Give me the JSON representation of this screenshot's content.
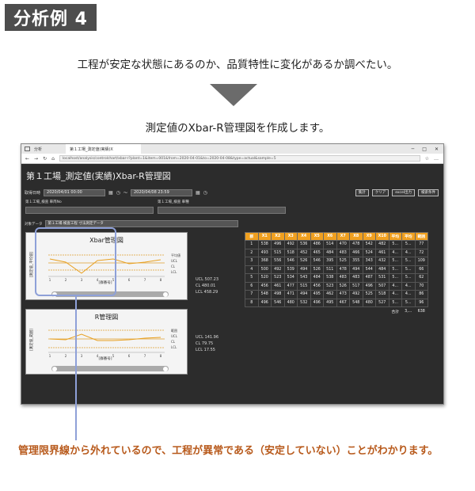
{
  "badge": "分析例 4",
  "intro": "工程が安定な状態にあるのか、品質特性に変化があるか調べたい。",
  "subtitle": "測定値のXbar-R管理図を作成します。",
  "browser": {
    "tab1": "分析",
    "tab2": "第１工場_測定値(実績)X",
    "url": "localhost/analysis/controlchart/xbar-r?plant=1&item=001&from=2020-04-01&to=2020-04-08&type=actual&sample=5",
    "win_min": "─",
    "win_max": "□",
    "win_close": "✕"
  },
  "app": {
    "title": "第１工場_測定値(実績)Xbar-R管理図",
    "date_label": "取得日時",
    "from": "2020/04/01 00:00",
    "to": "2020/04/08 23:59",
    "range_sep": "～",
    "buttons": [
      "集計",
      "クリア",
      "excel出力",
      "検索条件"
    ],
    "label_a": "第１工場_検査 車両No",
    "label_b": "第１工場_検査 車種",
    "target_label": "対象データ",
    "target_value": "第１工場 検査工程 寸法測定データ"
  },
  "xbar": {
    "title": "Xbar管理図",
    "ylabel": "[測定値_平均値]",
    "xlabel": "[群番号]",
    "legend": [
      "平均値",
      "UCL",
      "CL",
      "LCL"
    ],
    "stats": [
      "UCL  507.23",
      "CL    480.01",
      "LCL  458.29"
    ]
  },
  "rchart": {
    "title": "R管理図",
    "ylabel": "[測定値_範囲]",
    "xlabel": "[群番号]",
    "legend": [
      "範囲",
      "UCL",
      "CL",
      "LCL"
    ],
    "stats": [
      "UCL  141.96",
      "CL    79.75",
      "LCL  17.55"
    ]
  },
  "table": {
    "headers": [
      "群",
      "X1",
      "X2",
      "X3",
      "X4",
      "X5",
      "X6",
      "X7",
      "X8",
      "X9",
      "X10",
      "平均",
      "平均",
      "範囲"
    ],
    "rows": [
      [
        "1",
        "538",
        "496",
        "492",
        "536",
        "486",
        "514",
        "470",
        "478",
        "542",
        "482",
        "5...",
        "5...",
        "77"
      ],
      [
        "2",
        "493",
        "515",
        "518",
        "452",
        "465",
        "484",
        "483",
        "466",
        "524",
        "461",
        "4...",
        "4...",
        "72"
      ],
      [
        "3",
        "368",
        "556",
        "546",
        "526",
        "546",
        "395",
        "525",
        "355",
        "343",
        "432",
        "5...",
        "5...",
        "109"
      ],
      [
        "4",
        "500",
        "492",
        "539",
        "494",
        "526",
        "511",
        "478",
        "494",
        "544",
        "484",
        "5...",
        "5...",
        "66"
      ],
      [
        "5",
        "520",
        "523",
        "534",
        "543",
        "484",
        "538",
        "483",
        "483",
        "487",
        "531",
        "5...",
        "5...",
        "62"
      ],
      [
        "6",
        "456",
        "461",
        "477",
        "515",
        "456",
        "523",
        "526",
        "517",
        "496",
        "507",
        "4...",
        "4...",
        "70"
      ],
      [
        "7",
        "548",
        "498",
        "471",
        "494",
        "495",
        "462",
        "473",
        "492",
        "525",
        "518",
        "4...",
        "4...",
        "86"
      ],
      [
        "8",
        "496",
        "546",
        "480",
        "532",
        "496",
        "495",
        "467",
        "548",
        "480",
        "527",
        "5...",
        "5...",
        "96"
      ]
    ],
    "total_label": "合計",
    "total_avg": "3,...",
    "total_range": "638"
  },
  "note": "管理限界線から外れているので、工程が異常である（安定していない）ことがわかります。"
}
